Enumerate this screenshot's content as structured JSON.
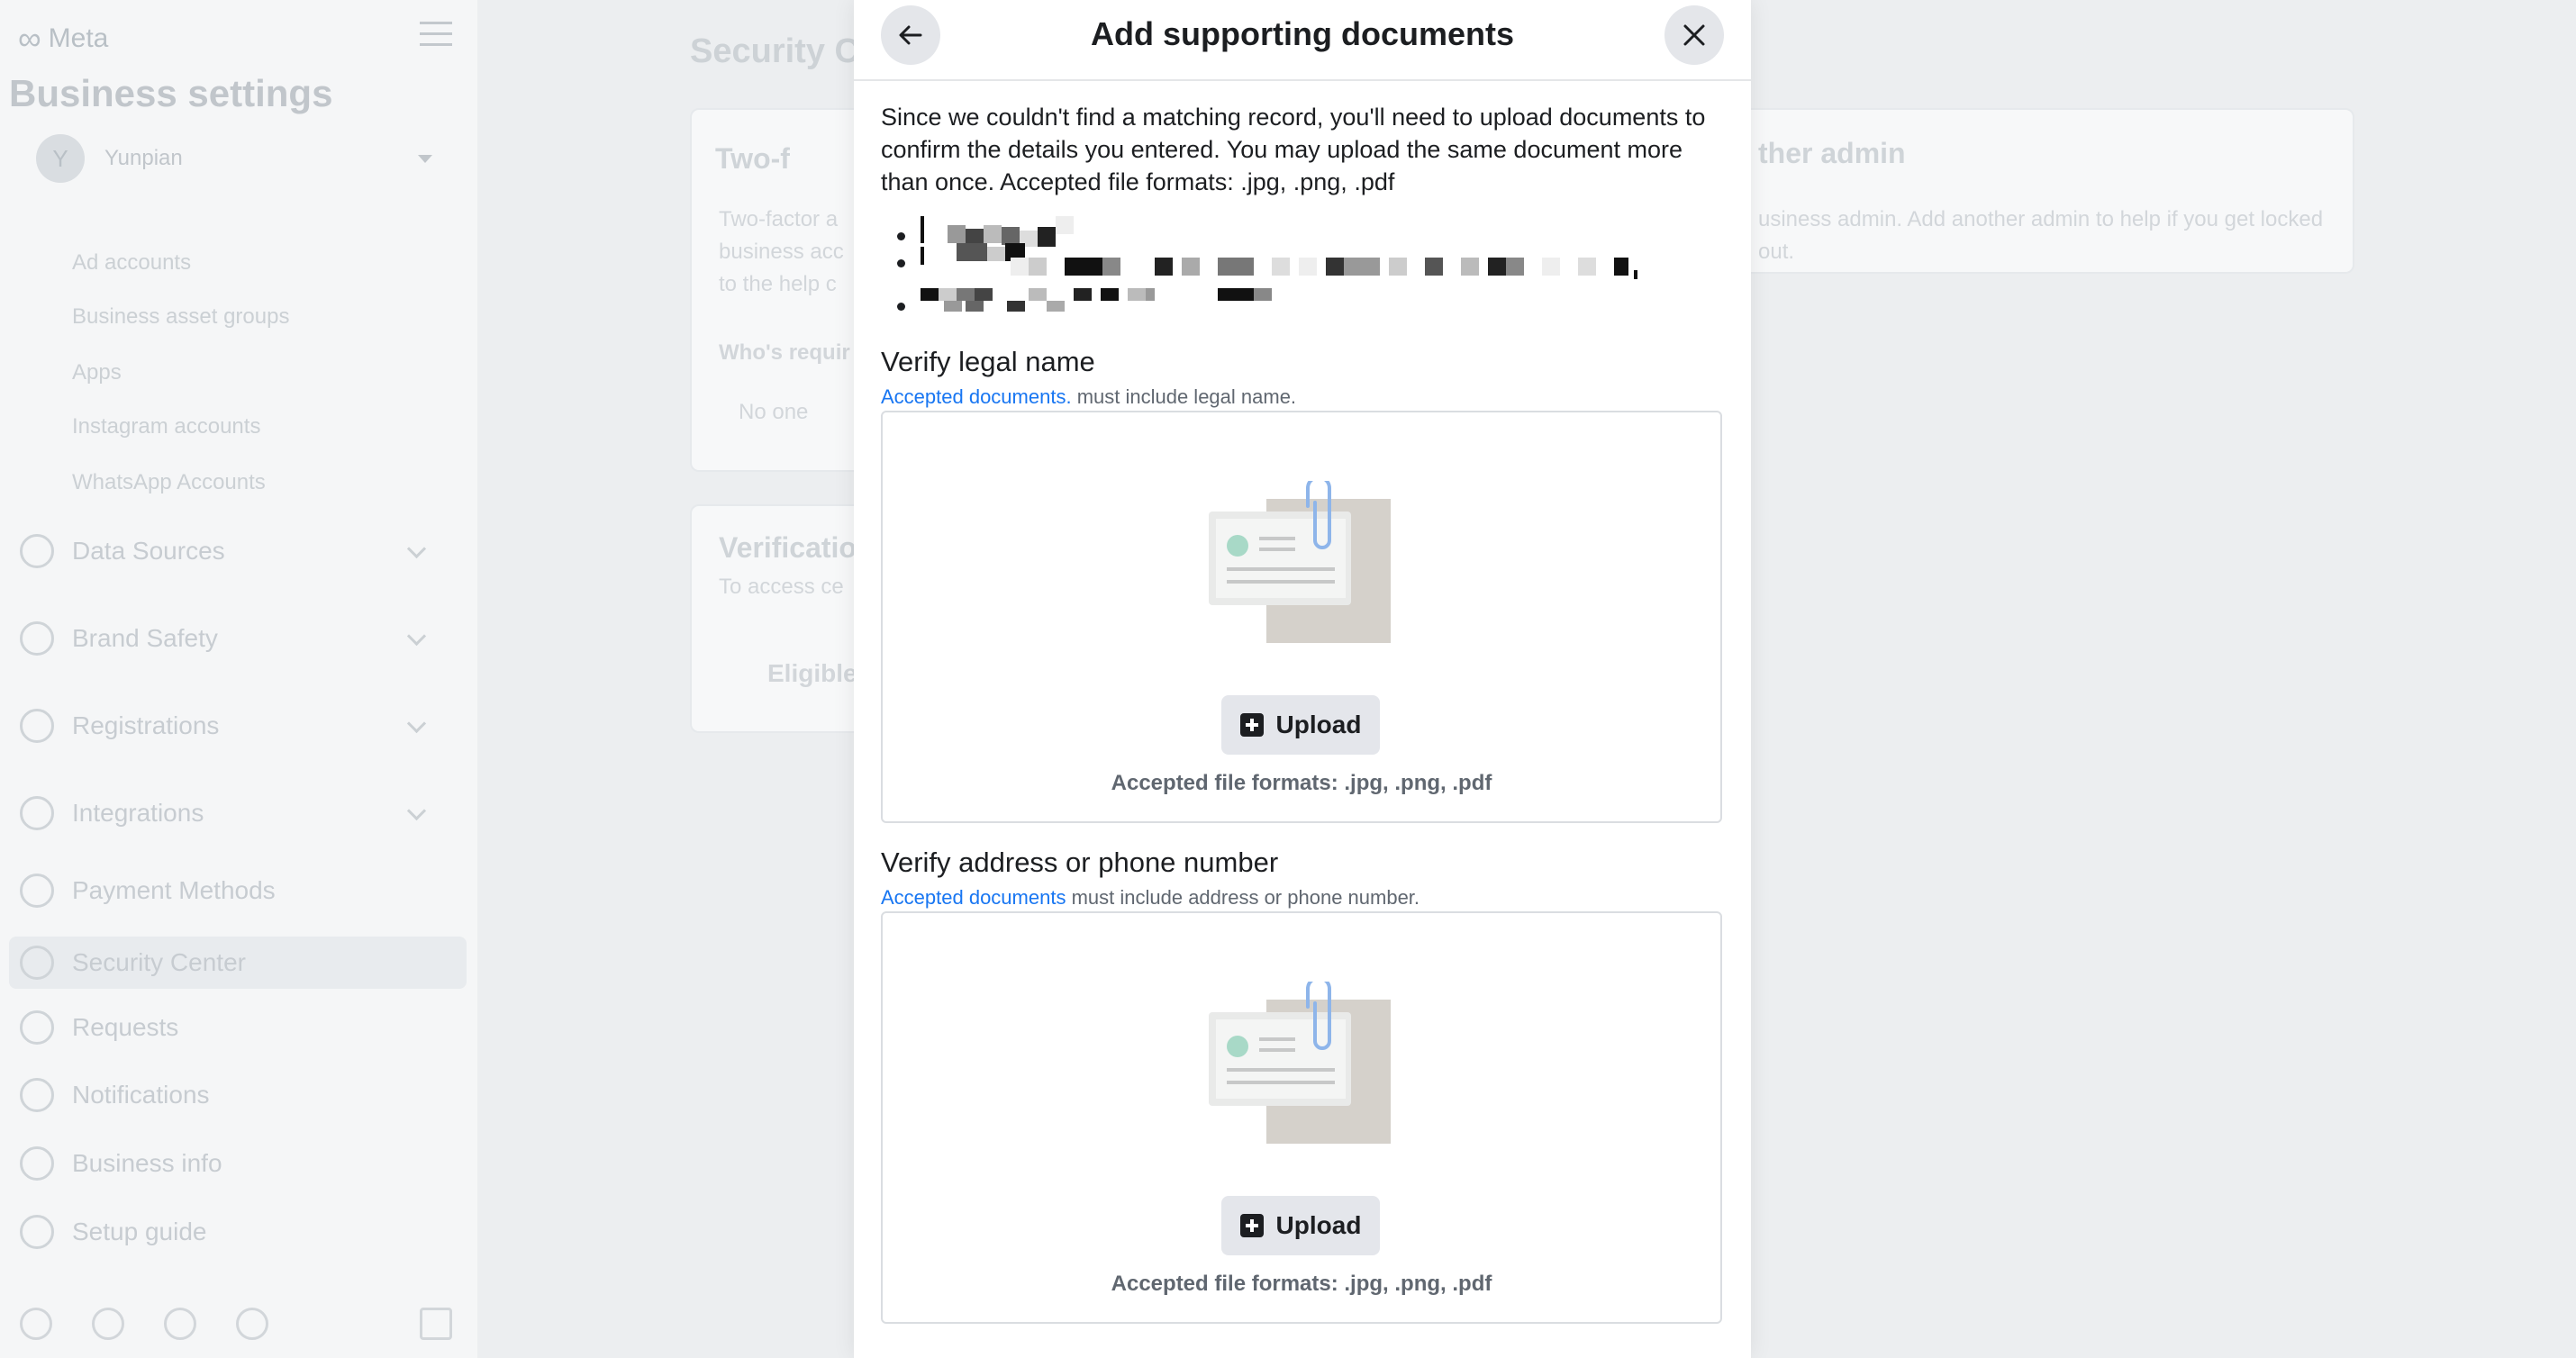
{
  "background": {
    "brand": "Meta",
    "title": "Business settings",
    "account": {
      "initial": "Y",
      "name": "Yunpian"
    },
    "sub_items": [
      "Ad accounts",
      "Business asset groups",
      "Apps",
      "Instagram accounts",
      "WhatsApp Accounts"
    ],
    "nav_items": [
      {
        "label": "Data Sources",
        "has_chevron": true
      },
      {
        "label": "Brand Safety",
        "has_chevron": true
      },
      {
        "label": "Registrations",
        "has_chevron": true
      },
      {
        "label": "Integrations",
        "has_chevron": true
      },
      {
        "label": "Payment Methods",
        "has_chevron": false
      },
      {
        "label": "Security Center",
        "has_chevron": false,
        "active": true
      },
      {
        "label": "Requests",
        "has_chevron": false
      },
      {
        "label": "Notifications",
        "has_chevron": false
      },
      {
        "label": "Business info",
        "has_chevron": false
      },
      {
        "label": "Setup guide",
        "has_chevron": false
      }
    ],
    "main_title": "Security Ce",
    "card1": {
      "title": "Two-f",
      "desc": "Two-factor a\nbusiness acc\nto the help c",
      "who": "Who's requir",
      "value": "No one"
    },
    "card2": {
      "title": "Verificatio",
      "desc": "To access ce",
      "eligible": "Eligible"
    },
    "card3": {
      "title": "ther admin",
      "desc": "usiness admin. Add another admin to help if you get locked\nout."
    }
  },
  "modal": {
    "title": "Add supporting documents",
    "intro": "Since we couldn't find a matching record, you'll need to upload documents to confirm the details you entered. You may upload the same document more than once. Accepted file formats: .jpg, .png, .pdf",
    "sections": [
      {
        "title": "Verify legal name",
        "link": "Accepted documents.",
        "sub": " must include legal name.",
        "upload_label": "Upload",
        "formats": "Accepted file formats: .jpg, .png, .pdf"
      },
      {
        "title": "Verify address or phone number",
        "link": "Accepted documents",
        "sub": " must include address or phone number.",
        "upload_label": "Upload",
        "formats": "Accepted file formats: .jpg, .png, .pdf"
      }
    ]
  },
  "icons": {
    "back": "arrow-left-icon",
    "close": "close-icon",
    "upload": "plus-square-icon",
    "illustration": "document-paperclip-illustration"
  }
}
